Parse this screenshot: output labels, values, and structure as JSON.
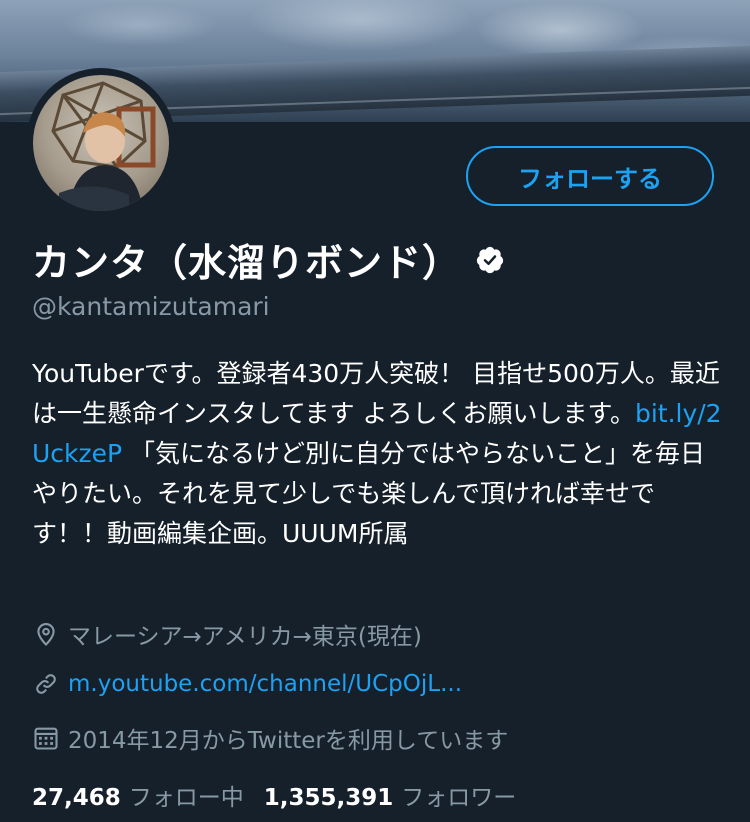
{
  "profile": {
    "display_name": "カンタ（水溜りボンド）",
    "handle": "@kantamizutamari",
    "follow_button_label": "フォローする",
    "bio": {
      "text_before_link": "YouTuberです。登録者430万人突破！ 目指せ500万人。最近は一生懸命インスタしてます よろしくお願いします。",
      "link": "bit.ly/2UckzeP",
      "text_after_link": " 「気になるけど別に自分ではやらないこと」を毎日やりたい。それを見て少しでも楽しんで頂ければ幸せです！！動画編集企画。UUUM所属"
    },
    "location": "マレーシア→アメリカ→東京(現在)",
    "website": "m.youtube.com/channel/UCpOjL...",
    "joined": "2014年12月からTwitterを利用しています",
    "stats": {
      "following_count": "27,468",
      "following_label": "フォロー中",
      "followers_count": "1,355,391",
      "followers_label": "フォロワー"
    }
  },
  "icons": {
    "verified": "verified-badge-icon",
    "location": "location-pin-icon",
    "link": "link-icon",
    "calendar": "calendar-icon"
  },
  "colors": {
    "background": "#15202b",
    "accent": "#1da1f2",
    "secondary_text": "#8899a6",
    "primary_text": "#ffffff"
  }
}
